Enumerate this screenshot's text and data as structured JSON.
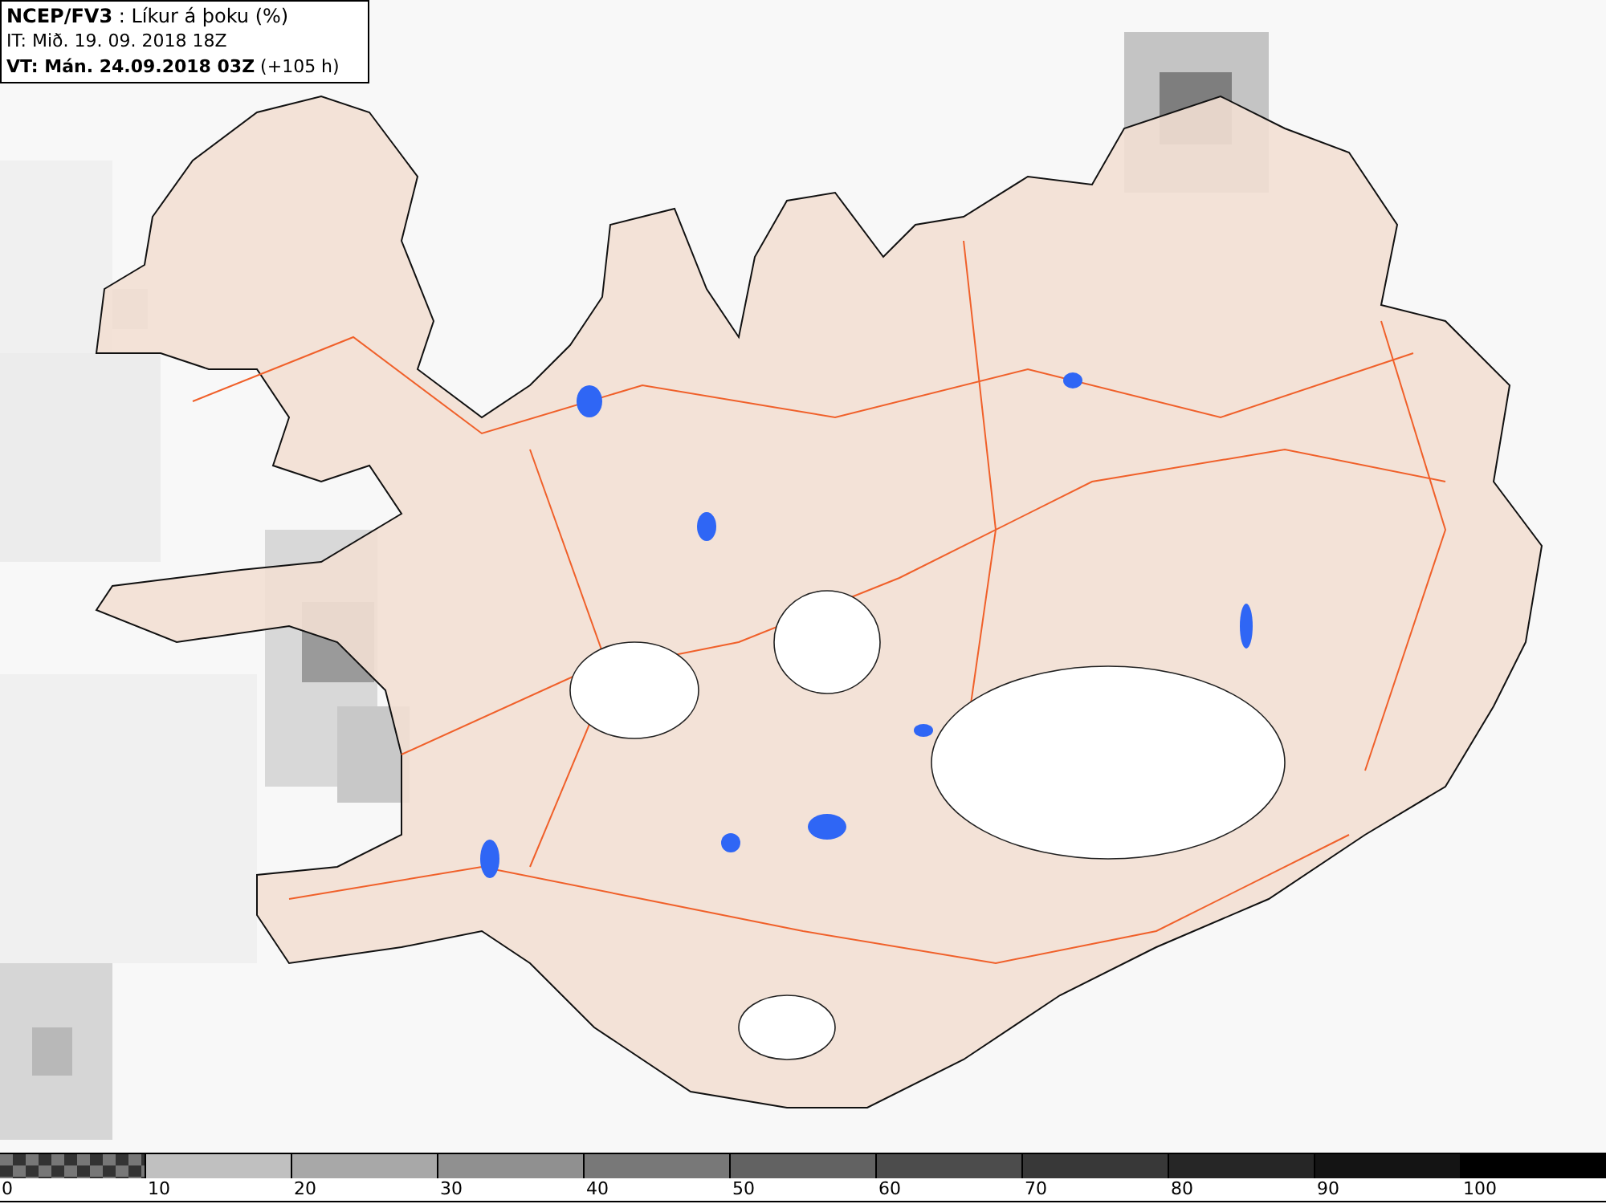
{
  "header": {
    "lines": [
      "**NCEP/FV3** : Líkur á þoku (%)",
      "IT: Mið. 19. 09. 2018 18Z",
      "**VT: Mán. 24.09.2018 03Z** (+105 h)"
    ]
  },
  "legend": {
    "segments": [
      {
        "kind": "checker",
        "label": "0"
      },
      {
        "kind": "solid",
        "color": "#c0c0c0",
        "label": "10"
      },
      {
        "kind": "solid",
        "color": "#a8a8a8",
        "label": "20"
      },
      {
        "kind": "solid",
        "color": "#909090",
        "label": "30"
      },
      {
        "kind": "solid",
        "color": "#787878",
        "label": "40"
      },
      {
        "kind": "solid",
        "color": "#626262",
        "label": "50"
      },
      {
        "kind": "solid",
        "color": "#4c4c4c",
        "label": "60"
      },
      {
        "kind": "solid",
        "color": "#383838",
        "label": "70"
      },
      {
        "kind": "solid",
        "color": "#262626",
        "label": "80"
      },
      {
        "kind": "solid",
        "color": "#141414",
        "label": "90"
      },
      {
        "kind": "solid",
        "color": "#000000",
        "label": "100"
      }
    ]
  }
}
